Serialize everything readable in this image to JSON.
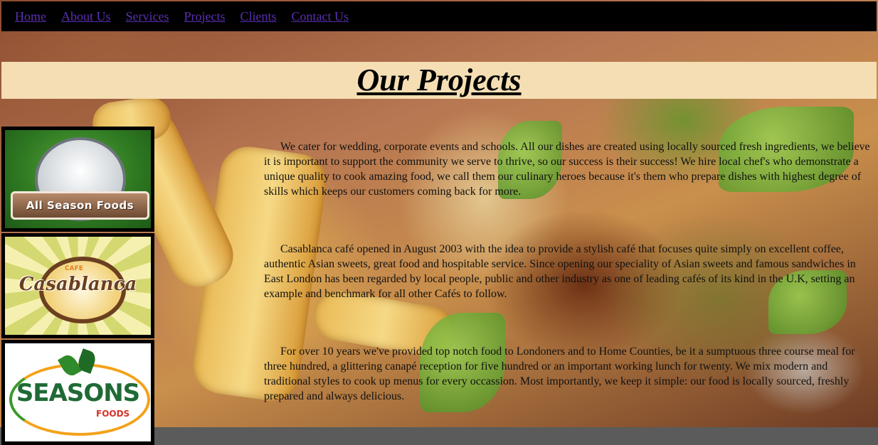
{
  "nav": {
    "items": [
      "Home",
      "About Us",
      "Services",
      "Projects",
      "Clients",
      "Contact Us"
    ]
  },
  "page": {
    "title": "Our Projects"
  },
  "logos": {
    "all_season": "All Season Foods",
    "casablanca_small": "CAFE",
    "casablanca": "Casablanca",
    "seasons": "SEASONS",
    "seasons_sub": "FOODS"
  },
  "paragraphs": [
    "We cater for wedding, corporate events and schools. All our dishes are created using locally sourced fresh ingredients, we believe it is important to support the community we serve to thrive, so our success is their success! We hire local chef's who demonstrate a unique quality to cook amazing food, we call them our culinary heroes because it's them who prepare dishes with highest degree of skills which keeps our customers coming back for more.",
    "Casablanca café opened in August 2003 with the idea to provide a stylish café that focuses quite simply on excellent coffee, authentic Asian sweets, great food and hospitable service. Since opening our speciality of Asian sweets and famous sandwiches in East London has been regarded by local people, public and other industry as one of leading cafés of its kind in the U.K, setting an example and benchmark for all other Cafés to follow.",
    "For over 10 years we've provided top notch food to Londoners and to Home Counties, be it a sumptuous three course meal for three hundred, a glittering canapé reception for five hundred or an important working lunch for twenty. We mix modern and traditional styles to cook up menus for every occassion. Most importantly, we keep it simple: our food is locally sourced, freshly prepared and always delicious."
  ],
  "colors": {
    "nav_bg": "#000000",
    "link": "#5a2fb0",
    "title_bg": "#f5deb3"
  }
}
